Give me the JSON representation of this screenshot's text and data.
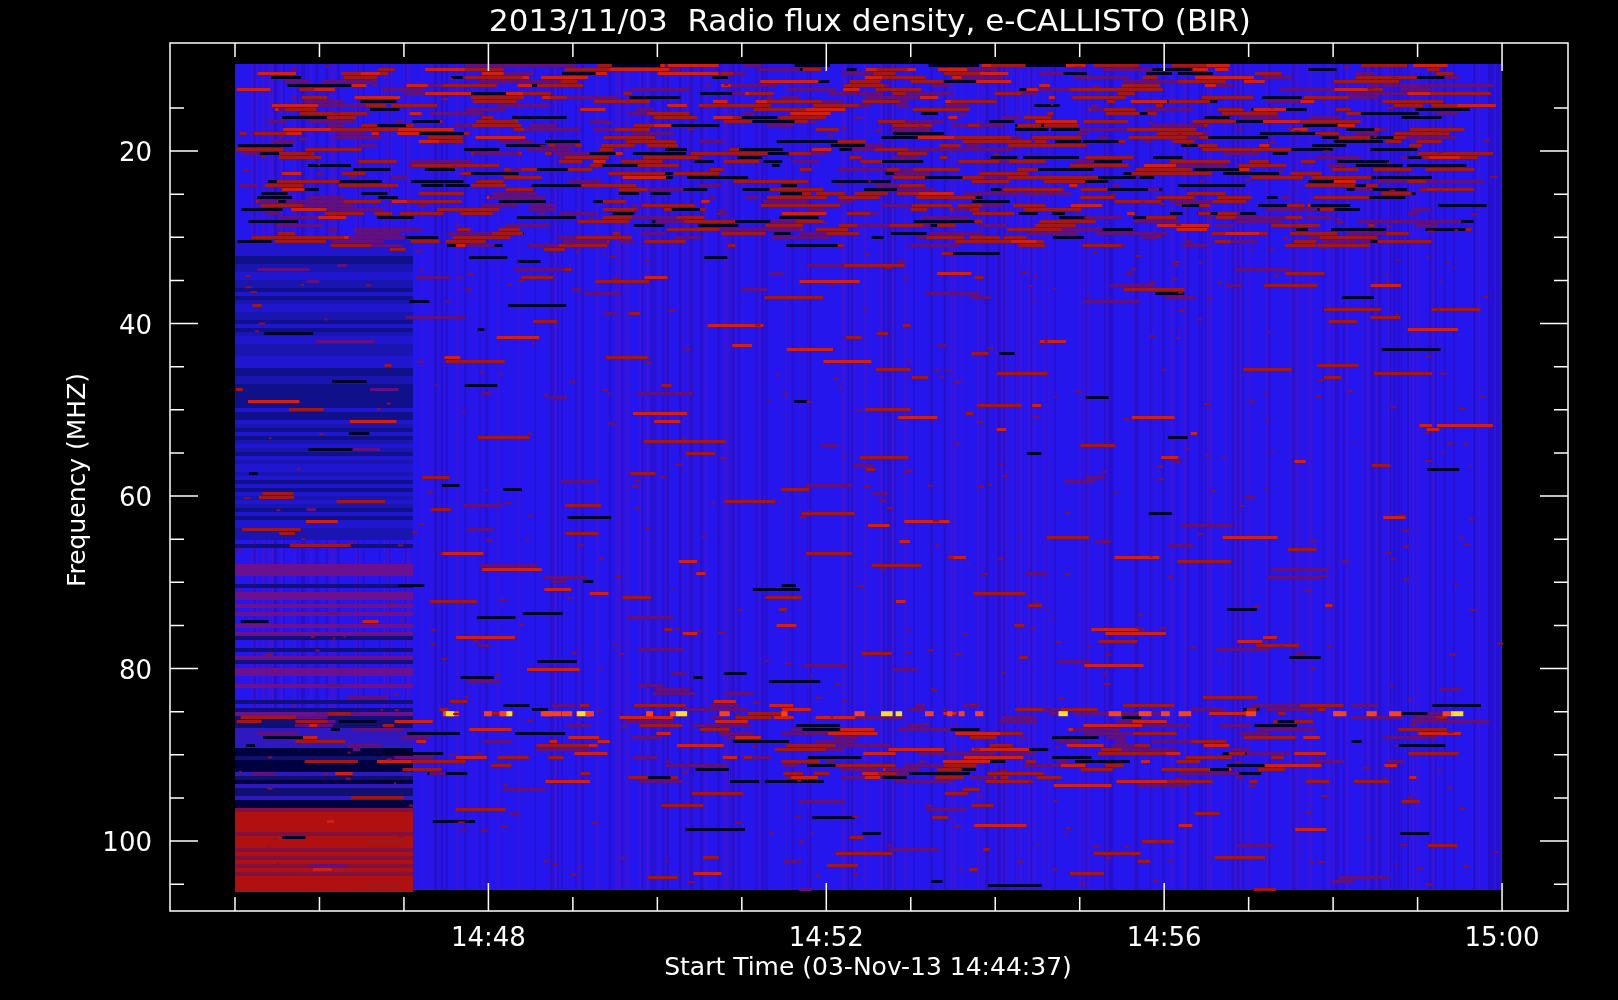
{
  "plot": {
    "title": "2013/11/03  Radio flux density, e-CALLISTO (BIR)",
    "y_axis_label": "Frequency (MHZ)",
    "x_axis_label": "Start Time (03-Nov-13 14:44:37)",
    "y_tick_labels": [
      "20",
      "40",
      "60",
      "80",
      "100"
    ],
    "x_tick_labels": [
      "14:48",
      "14:52",
      "14:56",
      "15:00"
    ]
  }
}
